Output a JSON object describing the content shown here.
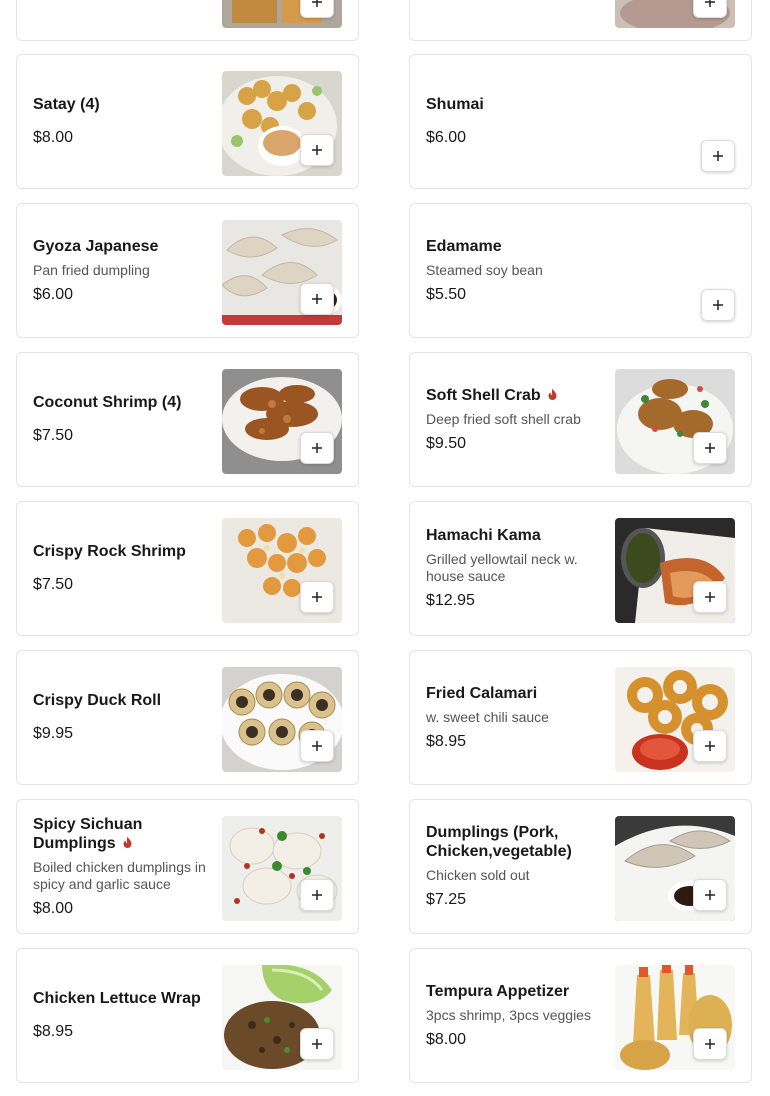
{
  "menu": {
    "items": [
      {
        "name": "Satay (4)",
        "description": "",
        "price": "$8.00",
        "spicy": false,
        "image": "satay-photo"
      },
      {
        "name": "Shumai",
        "description": "",
        "price": "$6.00",
        "spicy": false,
        "image": ""
      },
      {
        "name": "Gyoza Japanese",
        "description": "Pan fried dumpling",
        "price": "$6.00",
        "spicy": false,
        "image": "gyoza-photo"
      },
      {
        "name": "Edamame",
        "description": "Steamed soy bean",
        "price": "$5.50",
        "spicy": false,
        "image": ""
      },
      {
        "name": "Coconut Shrimp (4)",
        "description": "",
        "price": "$7.50",
        "spicy": false,
        "image": "coconut-shrimp-photo"
      },
      {
        "name": "Soft Shell Crab",
        "description": "Deep fried soft shell crab",
        "price": "$9.50",
        "spicy": true,
        "image": "soft-shell-crab-photo"
      },
      {
        "name": "Crispy Rock Shrimp",
        "description": "",
        "price": "$7.50",
        "spicy": false,
        "image": "rock-shrimp-photo"
      },
      {
        "name": "Hamachi Kama",
        "description": "Grilled yellowtail neck w. house sauce",
        "price": "$12.95",
        "spicy": false,
        "image": "hamachi-kama-photo"
      },
      {
        "name": "Crispy Duck Roll",
        "description": "",
        "price": "$9.95",
        "spicy": false,
        "image": "duck-roll-photo"
      },
      {
        "name": "Fried Calamari",
        "description": "w. sweet chili sauce",
        "price": "$8.95",
        "spicy": false,
        "image": "calamari-photo"
      },
      {
        "name": "Spicy Sichuan Dumplings",
        "description": "Boiled chicken dumplings in spicy and garlic sauce",
        "price": "$8.00",
        "spicy": true,
        "image": "sichuan-dumplings-photo"
      },
      {
        "name": "Dumplings (Pork, Chicken,vegetable)",
        "description": "Chicken sold out",
        "price": "$7.25",
        "spicy": false,
        "image": "dumplings-photo"
      },
      {
        "name": "Chicken Lettuce Wrap",
        "description": "",
        "price": "$8.95",
        "spicy": false,
        "image": "lettuce-wrap-photo"
      },
      {
        "name": "Tempura Appetizer",
        "description": "3pcs shrimp, 3pcs veggies",
        "price": "$8.00",
        "spicy": false,
        "image": "tempura-photo"
      }
    ]
  },
  "icons": {
    "add": "plus-icon",
    "spicy": "chili-flame-icon"
  },
  "colors": {
    "spicy": "#c0392b",
    "border": "#e4e4e4",
    "text": "#191919",
    "description": "#555555"
  }
}
